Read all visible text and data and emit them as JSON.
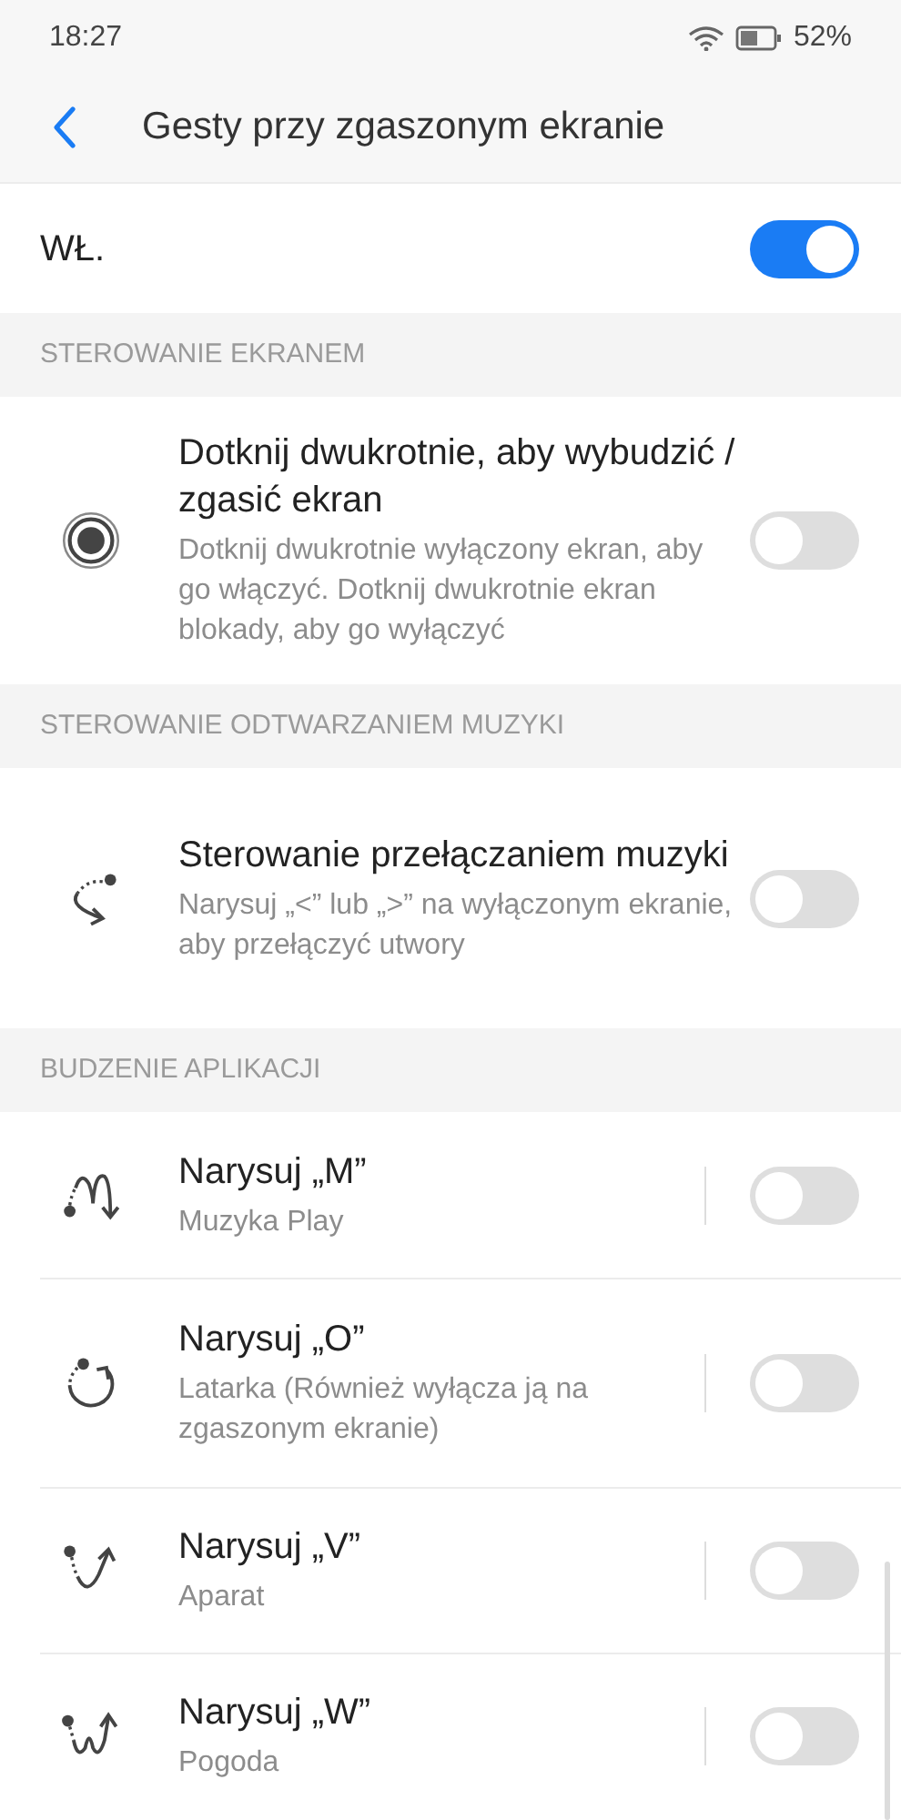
{
  "status_bar": {
    "time": "18:27",
    "battery": "52%"
  },
  "header": {
    "title": "Gesty przy zgaszonym ekranie"
  },
  "master": {
    "label": "WŁ.",
    "on": true
  },
  "sections": [
    {
      "title": "STEROWANIE EKRANEM",
      "items": [
        {
          "kind": "tap",
          "title": "Dotknij dwukrotnie, aby wybudzić / zgasić ekran",
          "description": "Dotknij dwukrotnie wyłączony ekran, aby go włączyć. Dotknij dwukrotnie ekran blokady, aby go wyłączyć",
          "on": false
        }
      ]
    },
    {
      "title": "STEROWANIE ODTWARZANIEM MUZYKI",
      "items": [
        {
          "kind": "swipe",
          "title": "Sterowanie przełączaniem muzyki",
          "description": "Narysuj „<” lub „>” na wyłączonym ekranie, aby przełączyć utwory",
          "on": false
        }
      ]
    },
    {
      "title": "BUDZENIE APLIKACJI",
      "items": [
        {
          "kind": "m",
          "title": "Narysuj „M”",
          "description": "Muzyka Play",
          "on": false
        },
        {
          "kind": "o",
          "title": "Narysuj „O”",
          "description": "Latarka (Również wyłącza ją na zgaszonym ekranie)",
          "on": false
        },
        {
          "kind": "v",
          "title": "Narysuj „V”",
          "description": "Aparat",
          "on": false
        },
        {
          "kind": "w",
          "title": "Narysuj „W”",
          "description": "Pogoda",
          "on": false
        }
      ]
    }
  ]
}
